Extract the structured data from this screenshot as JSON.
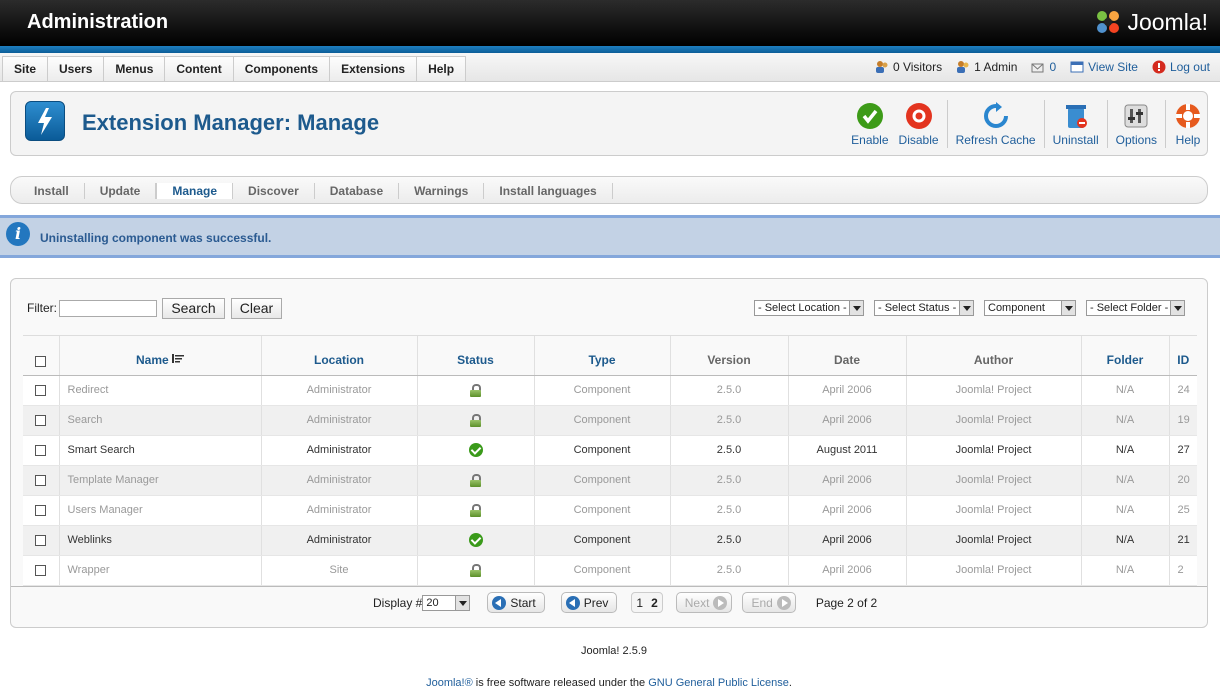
{
  "header": {
    "title": "Administration",
    "logo_text": "Joomla!"
  },
  "menu": {
    "items": [
      "Site",
      "Users",
      "Menus",
      "Content",
      "Components",
      "Extensions",
      "Help"
    ]
  },
  "status": {
    "visitors": "0 Visitors",
    "admins": "1 Admin",
    "messages": "0",
    "view_site": "View Site",
    "logout": "Log out"
  },
  "toolbar": {
    "title": "Extension Manager: Manage",
    "enable": "Enable",
    "disable": "Disable",
    "refresh_cache": "Refresh Cache",
    "uninstall": "Uninstall",
    "options": "Options",
    "help": "Help"
  },
  "submenu": {
    "items": [
      "Install",
      "Update",
      "Manage",
      "Discover",
      "Database",
      "Warnings",
      "Install languages"
    ],
    "active": "Manage"
  },
  "message": {
    "text": "Uninstalling component was successful."
  },
  "filter": {
    "label": "Filter:",
    "value": "",
    "search_label": "Search",
    "clear_label": "Clear",
    "location_select": "- Select Location -",
    "status_select": "- Select Status -",
    "type_select": "Component",
    "folder_select": "- Select Folder -"
  },
  "table": {
    "columns": [
      "Name",
      "Location",
      "Status",
      "Type",
      "Version",
      "Date",
      "Author",
      "Folder",
      "ID"
    ],
    "rows": [
      {
        "name": "Redirect",
        "location": "Administrator",
        "status": "locked",
        "type": "Component",
        "version": "2.5.0",
        "date": "April 2006",
        "author": "Joomla! Project",
        "folder": "N/A",
        "id": "24"
      },
      {
        "name": "Search",
        "location": "Administrator",
        "status": "locked",
        "type": "Component",
        "version": "2.5.0",
        "date": "April 2006",
        "author": "Joomla! Project",
        "folder": "N/A",
        "id": "19"
      },
      {
        "name": "Smart Search",
        "location": "Administrator",
        "status": "enabled",
        "type": "Component",
        "version": "2.5.0",
        "date": "August 2011",
        "author": "Joomla! Project",
        "folder": "N/A",
        "id": "27"
      },
      {
        "name": "Template Manager",
        "location": "Administrator",
        "status": "locked",
        "type": "Component",
        "version": "2.5.0",
        "date": "April 2006",
        "author": "Joomla! Project",
        "folder": "N/A",
        "id": "20"
      },
      {
        "name": "Users Manager",
        "location": "Administrator",
        "status": "locked",
        "type": "Component",
        "version": "2.5.0",
        "date": "April 2006",
        "author": "Joomla! Project",
        "folder": "N/A",
        "id": "25"
      },
      {
        "name": "Weblinks",
        "location": "Administrator",
        "status": "enabled",
        "type": "Component",
        "version": "2.5.0",
        "date": "April 2006",
        "author": "Joomla! Project",
        "folder": "N/A",
        "id": "21"
      },
      {
        "name": "Wrapper",
        "location": "Site",
        "status": "locked",
        "type": "Component",
        "version": "2.5.0",
        "date": "April 2006",
        "author": "Joomla! Project",
        "folder": "N/A",
        "id": "2"
      }
    ]
  },
  "pagination": {
    "display_label": "Display #",
    "display_value": "20",
    "start": "Start",
    "prev": "Prev",
    "pages": [
      "1",
      "2"
    ],
    "current_page": "2",
    "next": "Next",
    "end": "End",
    "page_info": "Page 2 of 2"
  },
  "footer": {
    "version": "Joomla! 2.5.9",
    "license_link": "Joomla!®",
    "license_text": " is free software released under the ",
    "gnu_link": "GNU General Public License",
    "license_end": "."
  }
}
